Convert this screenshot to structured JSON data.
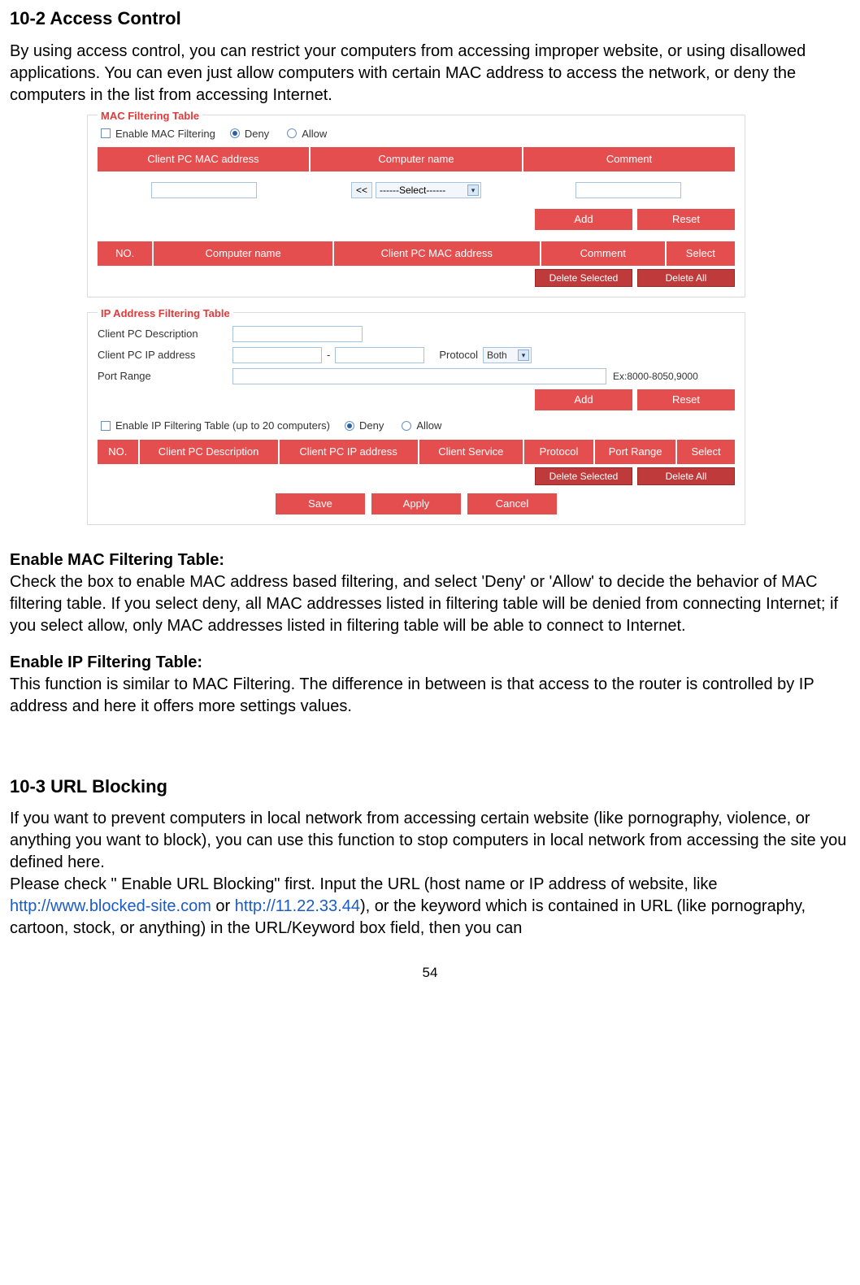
{
  "section1": {
    "title": "10-2 Access Control",
    "intro": "By using access control, you can restrict your computers from accessing improper website, or using disallowed applications. You can even just allow computers with certain MAC address to access the network, or deny the computers in the list from accessing Internet."
  },
  "macPanel": {
    "title": "MAC Filtering Table",
    "enableLabel": "Enable MAC Filtering",
    "deny": "Deny",
    "allow": "Allow",
    "headers": {
      "c1": "Client PC MAC address",
      "c2": "Computer name",
      "c3": "Comment"
    },
    "selectBtn": "<<",
    "selectPlaceholder": "------Select------",
    "add": "Add",
    "reset": "Reset",
    "headers2": {
      "no": "NO.",
      "name": "Computer name",
      "mac": "Client PC MAC address",
      "comment": "Comment",
      "select": "Select"
    },
    "delSel": "Delete Selected",
    "delAll": "Delete All"
  },
  "ipPanel": {
    "title": "IP Address Filtering Table",
    "descLabel": "Client PC Description",
    "ipLabel": "Client PC IP address",
    "protoLabel": "Protocol",
    "protoValue": "Both",
    "portLabel": "Port Range",
    "portHint": "Ex:8000-8050,9000",
    "add": "Add",
    "reset": "Reset",
    "enableLabel": "Enable IP Filtering Table (up to 20 computers)",
    "deny": "Deny",
    "allow": "Allow",
    "headers": {
      "no": "NO.",
      "desc": "Client PC Description",
      "ip": "Client PC IP address",
      "svc": "Client Service",
      "proto": "Protocol",
      "port": "Port Range",
      "sel": "Select"
    },
    "delSel": "Delete Selected",
    "delAll": "Delete All",
    "save": "Save",
    "apply": "Apply",
    "cancel": "Cancel"
  },
  "desc": {
    "macTitle": "Enable MAC Filtering Table:",
    "macBody": "Check the box to enable MAC address based filtering, and select 'Deny' or 'Allow' to decide the behavior of MAC filtering table. If you select deny, all MAC addresses listed in filtering table will be denied from connecting Internet; if you select allow, only MAC addresses listed in filtering table will be able to connect to Internet.",
    "ipTitle": "Enable IP Filtering Table:",
    "ipBody": "This function is similar to MAC Filtering. The difference in between is that access to the router is controlled by IP address and here it offers more settings values."
  },
  "section3": {
    "title": "10-3 URL Blocking",
    "p1a": "If you want to prevent computers in local network from accessing certain website (like pornography, violence, or anything you want to block), you can use this function to stop computers in local network from accessing the site you defined here.",
    "p2a": "Please check \" Enable URL Blocking\" first. Input the URL (host name or IP address of website, like ",
    "link1": "http://www.blocked-site.com",
    "p2b": " or ",
    "link2": "http://11.22.33.44",
    "p2c": "), or the keyword which is contained in URL (like pornography, cartoon, stock, or anything) in the URL/Keyword box field, then you can"
  },
  "pageNumber": "54"
}
